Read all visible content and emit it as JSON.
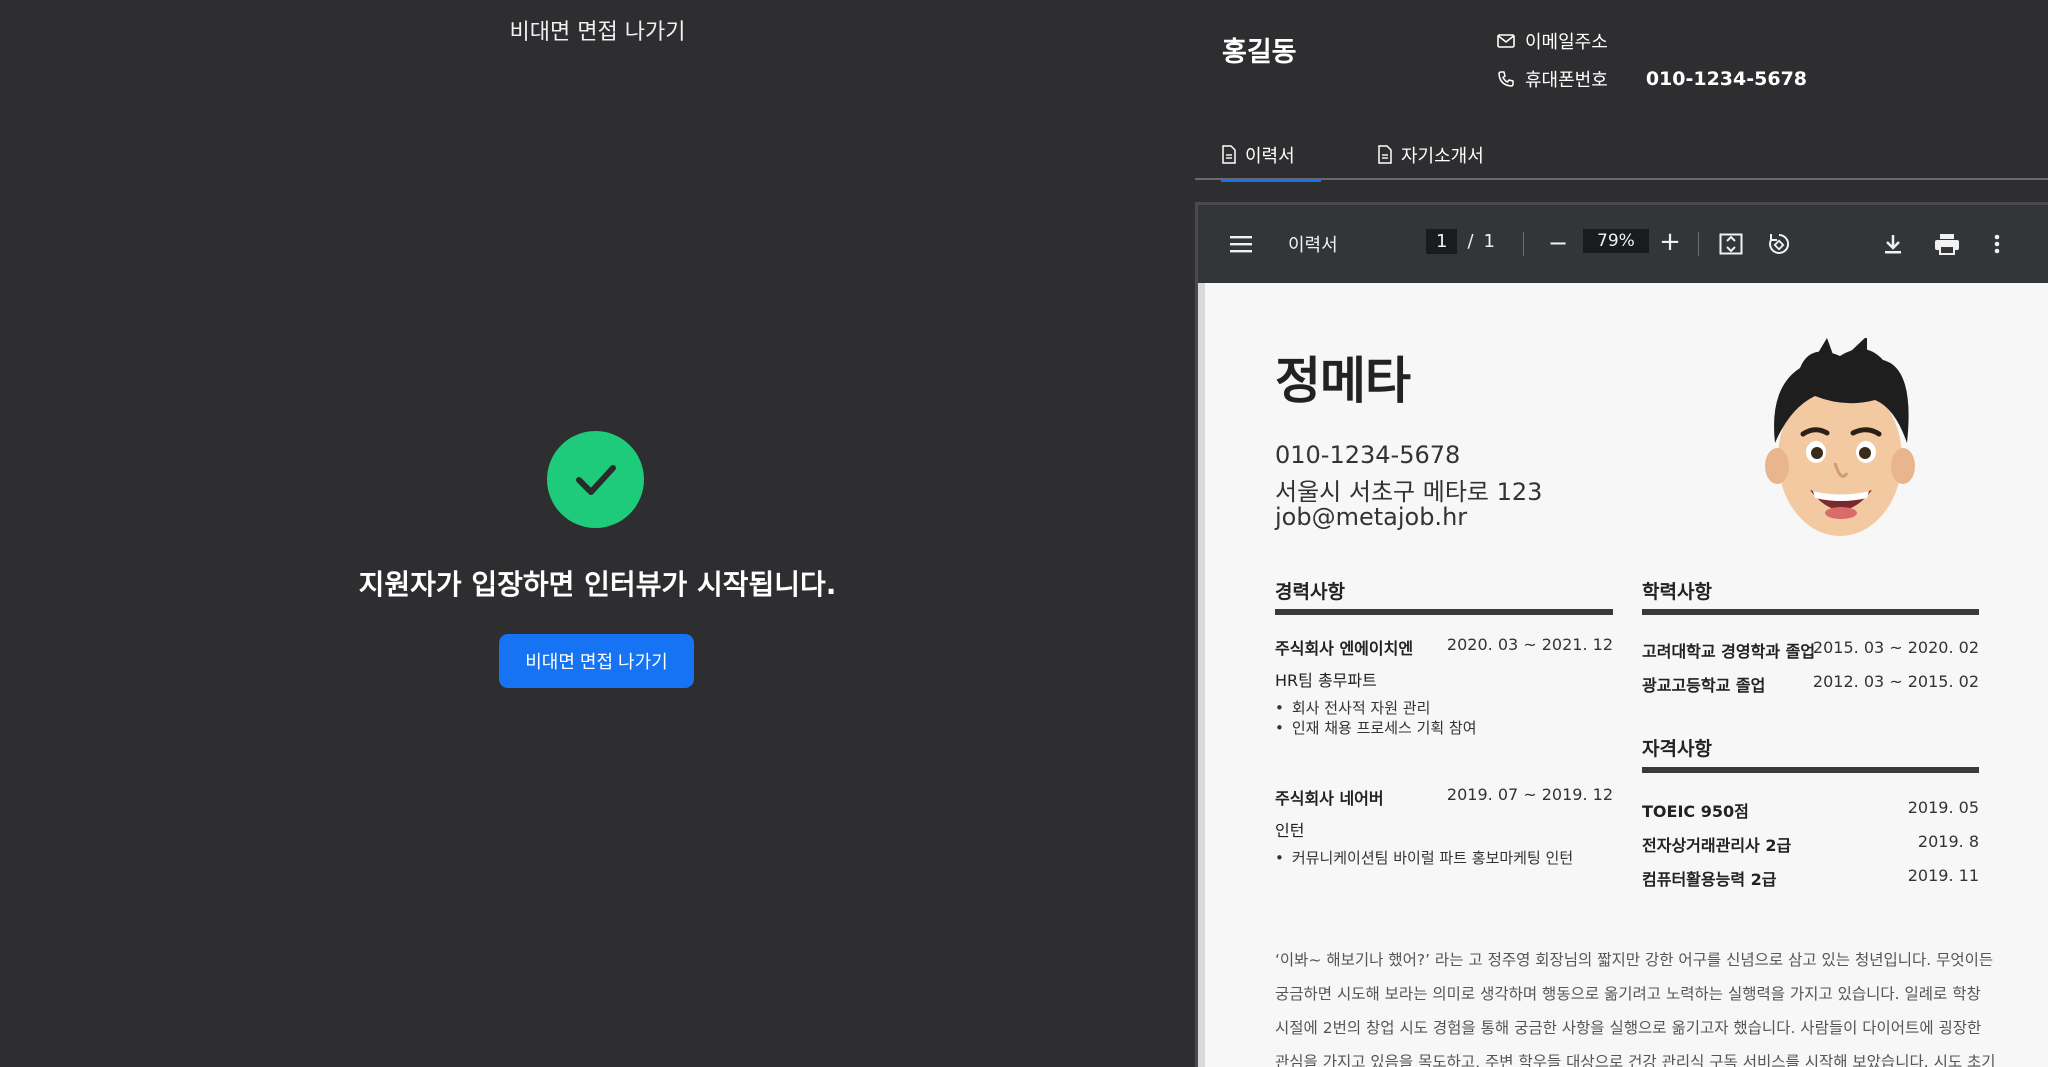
{
  "left": {
    "top_title": "비대면 면접 나가기",
    "status_text": "지원자가 입장하면 인터뷰가 시작됩니다.",
    "exit_button": "비대면 면접 나가기",
    "check_color": "#1ecb7a",
    "button_color": "#1673f3"
  },
  "candidate": {
    "name": "홍길동",
    "email_label": "이메일주소",
    "phone_label": "휴대폰번호",
    "phone_value": "010-1234-5678"
  },
  "tabs": [
    {
      "label": "이력서",
      "icon": "document-icon",
      "active": true
    },
    {
      "label": "자기소개서",
      "icon": "document-icon",
      "active": false
    }
  ],
  "pdf": {
    "title": "이력서",
    "page_current": "1",
    "page_sep": "/",
    "page_total": "1",
    "zoom": "79%",
    "minus": "−",
    "plus": "+"
  },
  "resume": {
    "name": "정메타",
    "phone": "010-1234-5678",
    "address": "서울시 서초구 메타로 123",
    "email": "job@metajob.hr",
    "career_title": "경력사항",
    "career": [
      {
        "company": "주식회사 엔에이치엔",
        "period": "2020. 03 ~ 2021. 12",
        "role": "HR팀 총무파트",
        "bullets": [
          "회사 전사적 자원 관리",
          "인재 채용 프로세스 기획 참여"
        ]
      },
      {
        "company": "주식회사 네어버",
        "period": "2019. 07 ~ 2019. 12",
        "role": "인턴",
        "bullets": [
          "커뮤니케이션팀 바이럴 파트 홍보마케팅 인턴"
        ]
      }
    ],
    "edu_title": "학력사항",
    "education": [
      {
        "name": "고려대학교 경영학과 졸업",
        "period": "2015. 03 ~ 2020. 02"
      },
      {
        "name": "광교고등학교 졸업",
        "period": "2012. 03 ~ 2015. 02"
      }
    ],
    "cert_title": "자격사항",
    "certs": [
      {
        "name": "TOEIC 950점",
        "date": "2019. 05"
      },
      {
        "name": "전자상거래관리사 2급",
        "date": "2019. 8"
      },
      {
        "name": "컴퓨터활용능력 2급",
        "date": "2019. 11"
      }
    ],
    "intro_lines": [
      "‘이봐~ 해보기나 했어?’ 라는 고 정주영 회장님의 짧지만 강한 어구를 신념으로 삼고 있는 청년입니다. 무엇이든",
      "궁금하면 시도해 보라는 의미로 생각하며 행동으로 옮기려고 노력하는 실행력을 가지고 있습니다. 일례로 학창",
      "시절에 2번의 창업 시도 경험을 통해 궁금한 사항을 실행으로 옮기고자 했습니다. 사람들이 다이어트에 굉장한",
      "관심을 가지고 있음을 목도하고, 주변 학우들 대상으로 건강 관리식 구독 서비스를 시작해 보았습니다. 시도 초기"
    ]
  }
}
